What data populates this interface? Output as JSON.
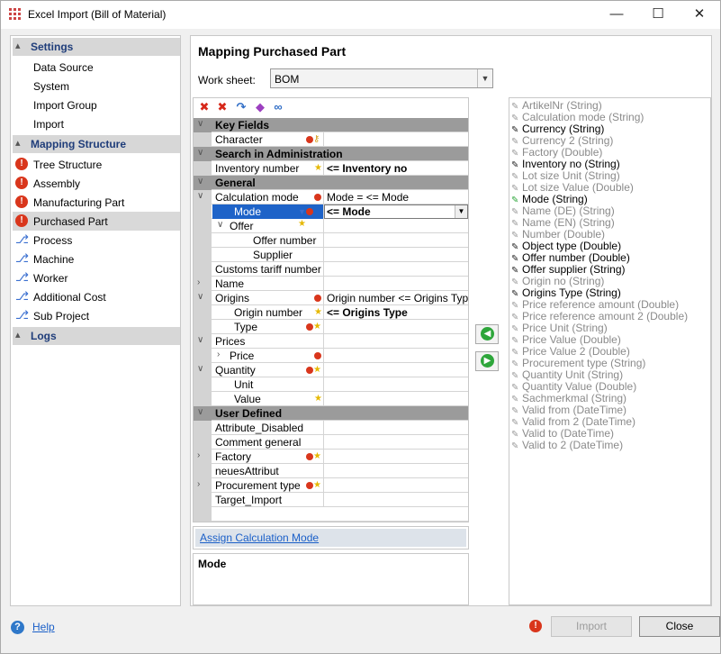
{
  "window": {
    "title": "Excel Import (Bill of Material)",
    "minimize_glyph": "—",
    "maximize_glyph": "☐",
    "close_glyph": "✕"
  },
  "nav": {
    "sections": [
      {
        "label": "Settings",
        "items": [
          {
            "label": "Data Source",
            "icon": "none"
          },
          {
            "label": "System",
            "icon": "none"
          },
          {
            "label": "Import Group",
            "icon": "none"
          },
          {
            "label": "Import",
            "icon": "none"
          }
        ]
      },
      {
        "label": "Mapping Structure",
        "items": [
          {
            "label": "Tree Structure",
            "icon": "error-icon"
          },
          {
            "label": "Assembly",
            "icon": "error-icon"
          },
          {
            "label": "Manufacturing Part",
            "icon": "error-icon"
          },
          {
            "label": "Purchased Part",
            "icon": "error-icon",
            "selected": true
          },
          {
            "label": "Process",
            "icon": "tree-icon"
          },
          {
            "label": "Machine",
            "icon": "tree-icon"
          },
          {
            "label": "Worker",
            "icon": "tree-icon"
          },
          {
            "label": "Additional Cost",
            "icon": "tree-icon"
          },
          {
            "label": "Sub Project",
            "icon": "tree-icon"
          }
        ]
      },
      {
        "label": "Logs",
        "items": []
      }
    ]
  },
  "mapping": {
    "title": "Mapping Purchased Part",
    "worksheet_label": "Work sheet:",
    "worksheet_value": "BOM",
    "rows": [
      {
        "type": "group",
        "name": "Key Fields"
      },
      {
        "type": "field",
        "indent": 0,
        "name": "Character",
        "badges": [
          "err",
          "key"
        ],
        "value": ""
      },
      {
        "type": "group",
        "name": "Search in Administration"
      },
      {
        "type": "field",
        "indent": 0,
        "name": "Inventory number",
        "badges": [
          "star"
        ],
        "value": "<= Inventory no",
        "bold": true
      },
      {
        "type": "group",
        "name": "General"
      },
      {
        "type": "field",
        "indent": 0,
        "expander": "v",
        "name": "Calculation mode",
        "badges": [
          "err"
        ],
        "value": "Mode = <= Mode"
      },
      {
        "type": "field",
        "indent": 1,
        "name": "Mode",
        "badges": [
          "filter",
          "err",
          "star"
        ],
        "value": "<= Mode",
        "bold": true,
        "selected": true
      },
      {
        "type": "field",
        "indent": 0,
        "expander": "v",
        "name": "Offer",
        "badges": [],
        "value": "",
        "tree_expander": true
      },
      {
        "type": "field",
        "indent": 2,
        "name": "Offer number",
        "badges": [],
        "value": ""
      },
      {
        "type": "field",
        "indent": 2,
        "name": "Supplier",
        "badges": [],
        "value": ""
      },
      {
        "type": "field",
        "indent": 0,
        "name": "Customs tariff number",
        "badges": [],
        "value": ""
      },
      {
        "type": "field",
        "indent": 0,
        "expander": ">",
        "name": "Name",
        "badges": [],
        "value": ""
      },
      {
        "type": "field",
        "indent": 0,
        "expander": "v",
        "name": "Origins",
        "badges": [
          "err"
        ],
        "value": "Origin number <= Origins Type"
      },
      {
        "type": "field",
        "indent": 1,
        "name": "Origin number",
        "badges": [
          "star"
        ],
        "value": "<= Origins Type",
        "bold": true
      },
      {
        "type": "field",
        "indent": 1,
        "name": "Type",
        "badges": [
          "err",
          "star"
        ],
        "value": ""
      },
      {
        "type": "field",
        "indent": 0,
        "expander": "v",
        "name": "Prices",
        "badges": [],
        "value": ""
      },
      {
        "type": "field",
        "indent": 0,
        "expander": ">",
        "name": "Price",
        "badges": [
          "err"
        ],
        "value": "",
        "tree_expander": true
      },
      {
        "type": "field",
        "indent": 0,
        "expander": "v",
        "name": "Quantity",
        "badges": [
          "err",
          "star"
        ],
        "value": ""
      },
      {
        "type": "field",
        "indent": 1,
        "name": "Unit",
        "badges": [],
        "value": ""
      },
      {
        "type": "field",
        "indent": 1,
        "name": "Value",
        "badges": [
          "star"
        ],
        "value": ""
      },
      {
        "type": "group",
        "name": "User Defined"
      },
      {
        "type": "field",
        "indent": 0,
        "name": "Attribute_Disabled",
        "badges": [],
        "value": ""
      },
      {
        "type": "field",
        "indent": 0,
        "name": "Comment general",
        "badges": [],
        "value": ""
      },
      {
        "type": "field",
        "indent": 0,
        "expander": ">",
        "name": "Factory",
        "badges": [
          "err",
          "star"
        ],
        "value": ""
      },
      {
        "type": "field",
        "indent": 0,
        "name": "neuesAttribut",
        "badges": [],
        "value": ""
      },
      {
        "type": "field",
        "indent": 0,
        "expander": ">",
        "name": "Procurement type",
        "badges": [
          "err",
          "star"
        ],
        "value": ""
      },
      {
        "type": "field",
        "indent": 0,
        "name": "Target_Import",
        "badges": [],
        "value": ""
      }
    ],
    "assign_link": "Assign Calculation Mode",
    "description_title": "Mode"
  },
  "source_columns": [
    {
      "name": "ArtikelNr",
      "type": "(String)",
      "used": false
    },
    {
      "name": "Calculation mode",
      "type": "(String)",
      "used": false
    },
    {
      "name": "Currency",
      "type": "(String)",
      "used": true
    },
    {
      "name": "Currency 2",
      "type": "(String)",
      "used": false
    },
    {
      "name": "Factory",
      "type": "(Double)",
      "used": false
    },
    {
      "name": "Inventory no",
      "type": "(String)",
      "used": true
    },
    {
      "name": "Lot size Unit",
      "type": "(String)",
      "used": false
    },
    {
      "name": "Lot size Value",
      "type": "(Double)",
      "used": false
    },
    {
      "name": "Mode",
      "type": "(String)",
      "used": true,
      "current": true
    },
    {
      "name": "Name (DE)",
      "type": "(String)",
      "used": false
    },
    {
      "name": "Name (EN)",
      "type": "(String)",
      "used": false
    },
    {
      "name": "Number",
      "type": "(Double)",
      "used": false
    },
    {
      "name": "Object type",
      "type": "(Double)",
      "used": true
    },
    {
      "name": "Offer number",
      "type": "(Double)",
      "used": true
    },
    {
      "name": "Offer supplier",
      "type": "(String)",
      "used": true
    },
    {
      "name": "Origin no",
      "type": "(String)",
      "used": false
    },
    {
      "name": "Origins Type",
      "type": "(String)",
      "used": true
    },
    {
      "name": "Price reference amount",
      "type": "(Double)",
      "used": false
    },
    {
      "name": "Price reference amount 2",
      "type": "(Double)",
      "used": false
    },
    {
      "name": "Price Unit",
      "type": "(String)",
      "used": false
    },
    {
      "name": "Price Value",
      "type": "(Double)",
      "used": false
    },
    {
      "name": "Price Value 2",
      "type": "(Double)",
      "used": false
    },
    {
      "name": "Procurement type",
      "type": "(String)",
      "used": false
    },
    {
      "name": "Quantity Unit",
      "type": "(String)",
      "used": false
    },
    {
      "name": "Quantity Value",
      "type": "(Double)",
      "used": false
    },
    {
      "name": "Sachmerkmal",
      "type": "(String)",
      "used": false
    },
    {
      "name": "Valid from",
      "type": "(DateTime)",
      "used": false
    },
    {
      "name": "Valid from 2",
      "type": "(DateTime)",
      "used": false
    },
    {
      "name": "Valid to",
      "type": "(DateTime)",
      "used": false
    },
    {
      "name": "Valid to 2",
      "type": "(DateTime)",
      "used": false
    }
  ],
  "footer": {
    "help_label": "Help",
    "import_label": "Import",
    "close_label": "Close"
  },
  "colors": {
    "accent": "#1e63c8",
    "error": "#d9361c",
    "group_row": "#9b9b9b",
    "assign_ok": "#2ea63b"
  }
}
